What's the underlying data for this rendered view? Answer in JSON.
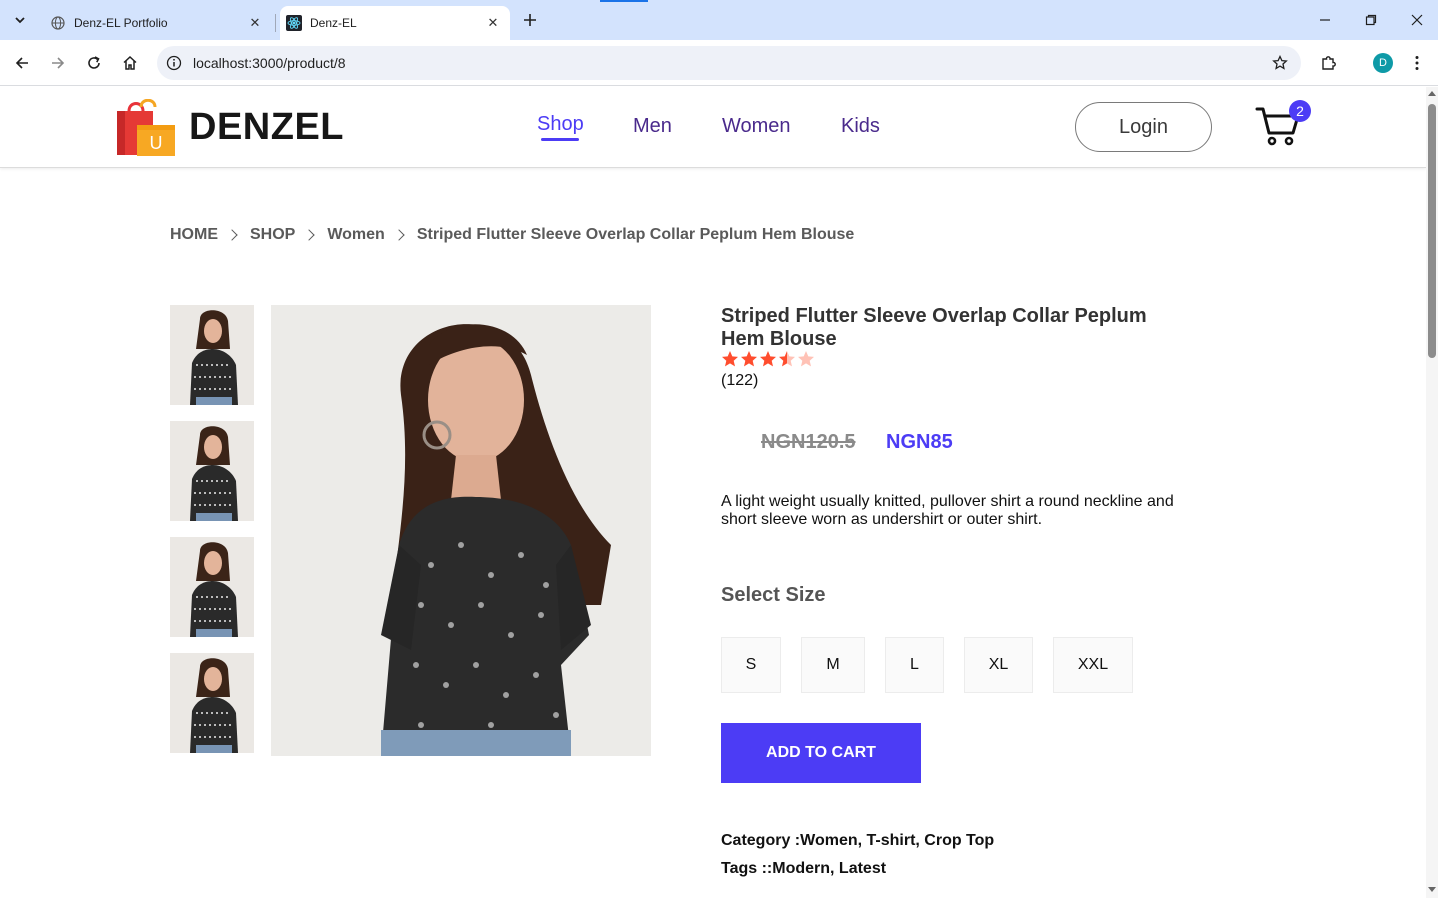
{
  "browser": {
    "tabs": [
      {
        "title": "Denz-EL Portfolio",
        "active": false
      },
      {
        "title": "Denz-EL",
        "active": true
      }
    ],
    "url": "localhost:3000/product/8",
    "profile_initial": "D"
  },
  "header": {
    "brand": "DENZEL",
    "logo_letter": "U",
    "nav": [
      "Shop",
      "Men",
      "Women",
      "Kids"
    ],
    "active_nav": "Shop",
    "login_label": "Login",
    "cart_count": "2"
  },
  "breadcrumb": [
    "HOME",
    "SHOP",
    "Women",
    "Striped Flutter Sleeve Overlap Collar Peplum Hem Blouse"
  ],
  "product": {
    "title": "Striped Flutter Sleeve Overlap Collar Peplum Hem Blouse",
    "rating": 3.5,
    "rating_max": 5,
    "reviews": "(122)",
    "old_price": "NGN120.5",
    "new_price": "NGN85",
    "description": "A light weight usually knitted, pullover shirt a round neckline and short sleeve worn as undershirt or outer shirt.",
    "size_label": "Select Size",
    "sizes": [
      "S",
      "M",
      "L",
      "XL",
      "XXL"
    ],
    "add_to_cart": "ADD TO CART",
    "category_label": "Category :",
    "category": "Women, T-shirt, Crop Top",
    "tags_label": "Tags ::",
    "tags": "Modern, Latest"
  },
  "colors": {
    "accent": "#4c3cf5",
    "nav_text": "#4a2a8c",
    "star": "#ff4d2e",
    "star_empty": "#ffc2b6"
  }
}
